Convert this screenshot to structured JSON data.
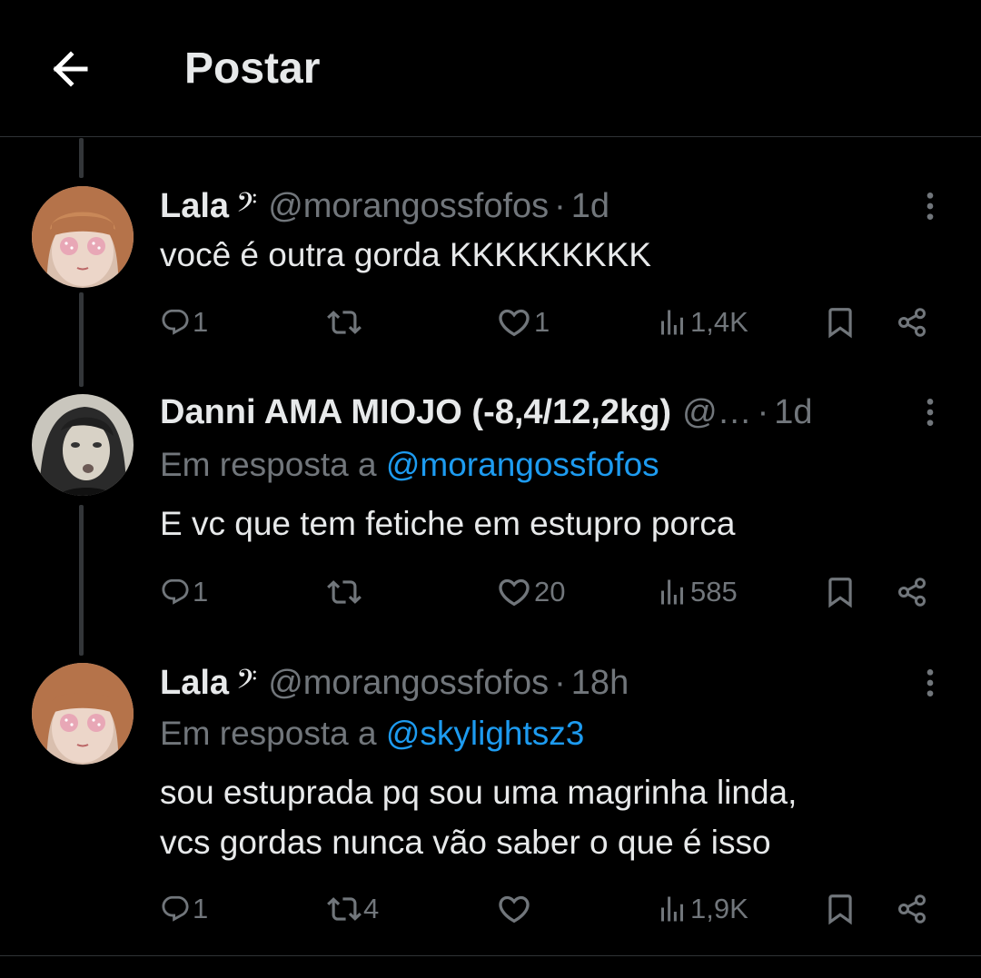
{
  "header": {
    "title": "Postar"
  },
  "tweets": [
    {
      "name": "Lala",
      "badge": "𝄢",
      "badge_icon": "music-note-icon",
      "handle": "@morangossfofos",
      "dot": "·",
      "time": "1d",
      "reply_prefix": "",
      "reply_handle": "",
      "lines": [
        "você é outra gorda KKKKKKKKK"
      ],
      "replies": "1",
      "reposts": "",
      "likes": "1",
      "views": "1,4K"
    },
    {
      "name": "Danni AMA MIOJO (-8,4/12,2kg)",
      "badge": "",
      "handle": "@…",
      "dot": "·",
      "time": "1d",
      "reply_prefix": "Em resposta a ",
      "reply_handle": "@morangossfofos",
      "lines": [
        "E vc que tem fetiche em estupro porca"
      ],
      "replies": "1",
      "reposts": "",
      "likes": "20",
      "views": "585"
    },
    {
      "name": "Lala",
      "badge": "𝄢",
      "badge_icon": "music-note-icon",
      "handle": "@morangossfofos",
      "dot": "·",
      "time": "18h",
      "reply_prefix": "Em resposta a ",
      "reply_handle": "@skylightsz3",
      "lines": [
        "sou estuprada pq sou uma magrinha linda,",
        "vcs gordas nunca vão saber o que é isso"
      ],
      "replies": "1",
      "reposts": "4",
      "likes": "",
      "views": "1,9K"
    }
  ],
  "icons": {
    "reply": "reply-icon",
    "repost": "repost-icon",
    "like": "heart-icon",
    "views": "views-icon",
    "bookmark": "bookmark-icon",
    "share": "share-icon",
    "more": "more-icon",
    "back": "back-arrow-icon"
  },
  "colors": {
    "background": "#000000",
    "text": "#e7e9ea",
    "muted": "#71767b",
    "link": "#1d9bf0",
    "divider": "#2f3336"
  }
}
